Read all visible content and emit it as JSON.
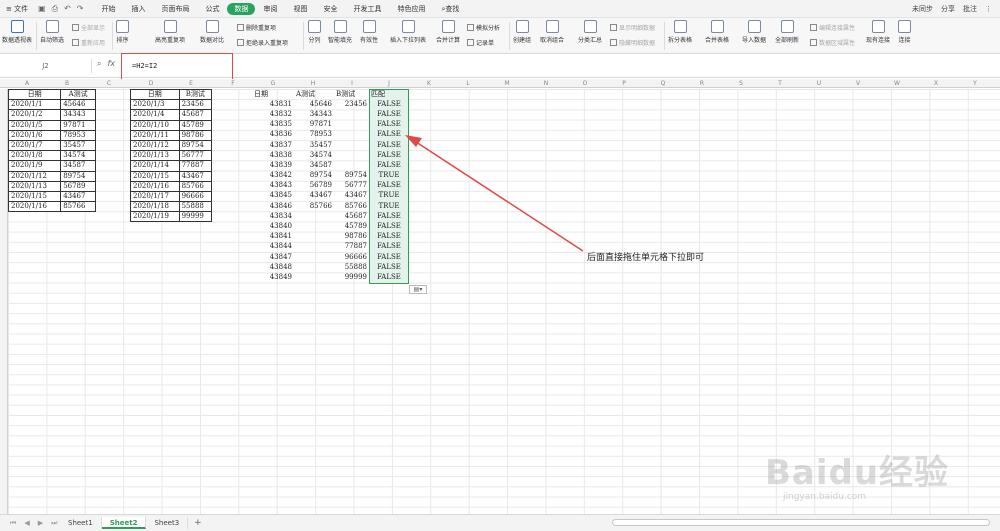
{
  "menubar": {
    "file_label": "文件",
    "tabs": [
      "开始",
      "插入",
      "页面布局",
      "公式",
      "数据",
      "审阅",
      "视图",
      "安全",
      "开发工具",
      "特色应用"
    ],
    "active_tab": "数据",
    "search_label": "查找",
    "right": {
      "sync": "未同步",
      "share": "分享",
      "annotate": "批注"
    }
  },
  "ribbon": {
    "pivot": "数据透视表",
    "auto_filter": "自动筛选",
    "show_all": "全部显示",
    "reapply": "重新应用",
    "sort": "排序",
    "highlight_dup": "高亮重复项",
    "compare": "数据对比",
    "delete_dup": "删除重复项",
    "reject_dup": "拒绝录入重复项",
    "split": "分列",
    "smart_fill": "智能填充",
    "validity": "有效性",
    "insert_dropdown": "插入下拉列表",
    "consolidate": "合并计算",
    "simulate": "模拟分析",
    "record": "记录单",
    "create_group": "创建组",
    "ungroup": "取消组合",
    "subtotal": "分类汇总",
    "show_detail": "显示明细数据",
    "hide_detail": "隐藏明细数据",
    "split_table": "拆分表格",
    "merge_table": "合并表格",
    "import": "导入数据",
    "refresh_all": "全部刷新",
    "edit_query": "编辑连接属性",
    "data_range": "数据区域属性",
    "existing_conn": "现有连接",
    "connect": "连接"
  },
  "formula_bar": {
    "name_box": "J2",
    "fx": "fx",
    "formula": "=H2=I2"
  },
  "columns": [
    "A",
    "B",
    "C",
    "D",
    "E",
    "F",
    "G",
    "H",
    "I",
    "J",
    "K",
    "L",
    "M",
    "N",
    "O",
    "P",
    "Q",
    "R",
    "S",
    "T",
    "U",
    "V",
    "W",
    "X",
    "Y"
  ],
  "table1": {
    "headers": [
      "日期",
      "A测试"
    ],
    "rows": [
      [
        "2020/1/1",
        "45646"
      ],
      [
        "2020/1/2",
        "34343"
      ],
      [
        "2020/1/5",
        "97871"
      ],
      [
        "2020/1/6",
        "78953"
      ],
      [
        "2020/1/7",
        "35457"
      ],
      [
        "2020/1/8",
        "34574"
      ],
      [
        "2020/1/9",
        "34587"
      ],
      [
        "2020/1/12",
        "89754"
      ],
      [
        "2020/1/13",
        "56789"
      ],
      [
        "2020/1/15",
        "43467"
      ],
      [
        "2020/1/16",
        "85766"
      ]
    ]
  },
  "table2": {
    "headers": [
      "日期",
      "B测试"
    ],
    "rows": [
      [
        "2020/1/3",
        "23456"
      ],
      [
        "2020/1/4",
        "45687"
      ],
      [
        "2020/1/10",
        "45789"
      ],
      [
        "2020/1/11",
        "98786"
      ],
      [
        "2020/1/12",
        "89754"
      ],
      [
        "2020/1/13",
        "56777"
      ],
      [
        "2020/1/14",
        "77887"
      ],
      [
        "2020/1/15",
        "43467"
      ],
      [
        "2020/1/16",
        "85766"
      ],
      [
        "2020/1/17",
        "96666"
      ],
      [
        "2020/1/18",
        "55888"
      ],
      [
        "2020/1/19",
        "99999"
      ]
    ]
  },
  "table3": {
    "headers": [
      "日期",
      "A测试",
      "B测试",
      "匹配"
    ],
    "rows": [
      [
        "43831",
        "45646",
        "23456",
        "FALSE"
      ],
      [
        "43832",
        "34343",
        "",
        "FALSE"
      ],
      [
        "43835",
        "97871",
        "",
        "FALSE"
      ],
      [
        "43836",
        "78953",
        "",
        "FALSE"
      ],
      [
        "43837",
        "35457",
        "",
        "FALSE"
      ],
      [
        "43838",
        "34574",
        "",
        "FALSE"
      ],
      [
        "43839",
        "34587",
        "",
        "FALSE"
      ],
      [
        "43842",
        "89754",
        "89754",
        "TRUE"
      ],
      [
        "43843",
        "56789",
        "56777",
        "FALSE"
      ],
      [
        "43845",
        "43467",
        "43467",
        "TRUE"
      ],
      [
        "43846",
        "85766",
        "85766",
        "TRUE"
      ],
      [
        "43834",
        "",
        "45687",
        "FALSE"
      ],
      [
        "43840",
        "",
        "45789",
        "FALSE"
      ],
      [
        "43841",
        "",
        "98786",
        "FALSE"
      ],
      [
        "43844",
        "",
        "77887",
        "FALSE"
      ],
      [
        "43847",
        "",
        "96666",
        "FALSE"
      ],
      [
        "43848",
        "",
        "55888",
        "FALSE"
      ],
      [
        "43849",
        "",
        "99999",
        "FALSE"
      ]
    ]
  },
  "annotation": "后面直接拖住单元格下拉即可",
  "sheets": [
    "Sheet1",
    "Sheet2",
    "Sheet3"
  ],
  "active_sheet": "Sheet2",
  "watermark": {
    "logo": "Baidu经验",
    "url": "jingyan.baidu.com"
  },
  "colors": {
    "accent_green": "#2e9d55",
    "annotation_red": "#e24848"
  }
}
